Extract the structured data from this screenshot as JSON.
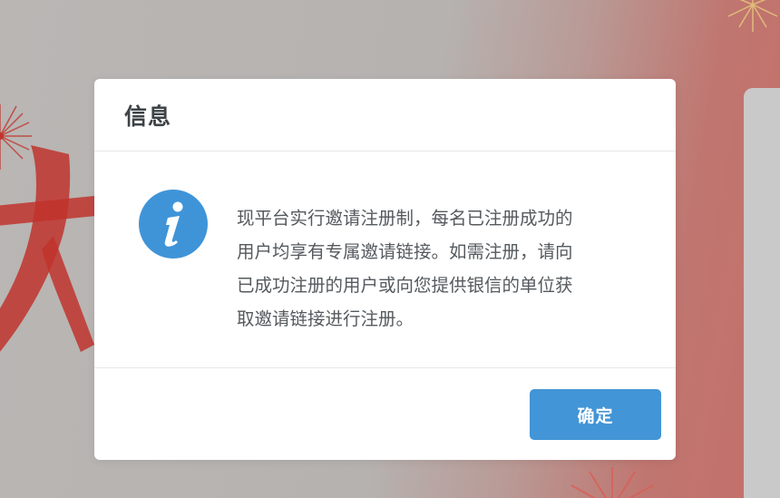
{
  "background": {
    "colors": {
      "overlay": "#b8b5b3",
      "accent_red": "#c46f68",
      "decor_red": "#c0342d"
    }
  },
  "dialog": {
    "title": "信息",
    "icon": "info-icon",
    "message_lines": [
      "现平台实行邀请注册制，每名已注册成功的",
      "用户均享有专属邀请链接。如需注册，请向",
      "已成功注册的用户或向您提供银信的单位获",
      "取邀请链接进行注册。"
    ],
    "confirm_label": "确定",
    "colors": {
      "primary_button": "#4295d6",
      "icon_blue": "#3f94d8",
      "text": "#555a5e",
      "title": "#3d4347"
    }
  }
}
